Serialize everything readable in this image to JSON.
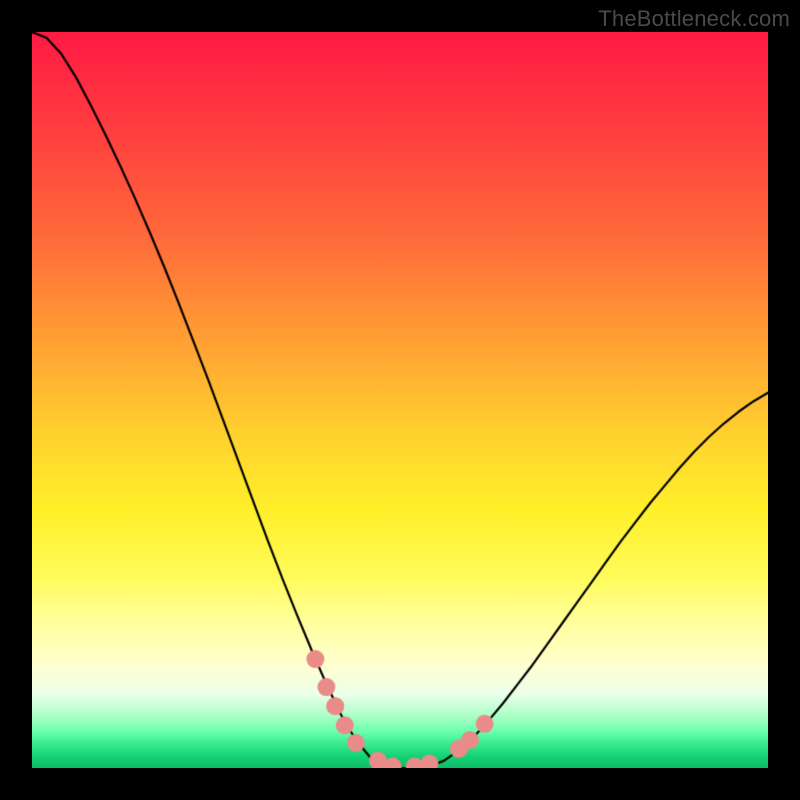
{
  "watermark": "TheBottleneck.com",
  "colors": {
    "frame_bg": "#000000",
    "curve_stroke": "#000000",
    "highlight_dots": "#e98b88"
  },
  "chart_data": {
    "type": "line",
    "title": "",
    "xlabel": "",
    "ylabel": "",
    "xlim": [
      0,
      100
    ],
    "ylim": [
      0,
      100
    ],
    "grid": false,
    "legend": false,
    "x": [
      0,
      2,
      4,
      6,
      8,
      10,
      12,
      14,
      16,
      18,
      20,
      22,
      24,
      26,
      28,
      30,
      32,
      34,
      36,
      38,
      40,
      42,
      44,
      46,
      48,
      50,
      52,
      54,
      56,
      58,
      60,
      62,
      64,
      66,
      68,
      70,
      72,
      74,
      76,
      78,
      80,
      82,
      84,
      86,
      88,
      90,
      92,
      94,
      96,
      98,
      100
    ],
    "series": [
      {
        "name": "bottleneck-curve",
        "values": [
          100,
          99.2,
          97.0,
          93.8,
          90.0,
          86.0,
          81.8,
          77.4,
          72.8,
          68.0,
          63.0,
          57.8,
          52.6,
          47.2,
          41.8,
          36.4,
          31.0,
          25.8,
          20.8,
          16.0,
          11.4,
          7.2,
          3.8,
          1.4,
          0.2,
          0.0,
          0.0,
          0.2,
          1.0,
          2.4,
          4.2,
          6.4,
          8.8,
          11.4,
          14.0,
          16.8,
          19.6,
          22.4,
          25.2,
          28.0,
          30.8,
          33.4,
          36.0,
          38.4,
          40.8,
          43.0,
          45.0,
          46.8,
          48.4,
          49.8,
          51.0
        ]
      }
    ],
    "highlight_points": {
      "name": "highlighted-samples",
      "color": "#e98b88",
      "x": [
        38.5,
        40.0,
        41.2,
        42.5,
        44.0,
        47.0,
        49.0,
        52.0,
        54.0,
        58.0,
        59.5,
        61.5
      ],
      "values": [
        14.8,
        11.0,
        8.4,
        5.8,
        3.4,
        1.0,
        0.2,
        0.2,
        0.6,
        2.6,
        3.8,
        6.0
      ]
    }
  }
}
